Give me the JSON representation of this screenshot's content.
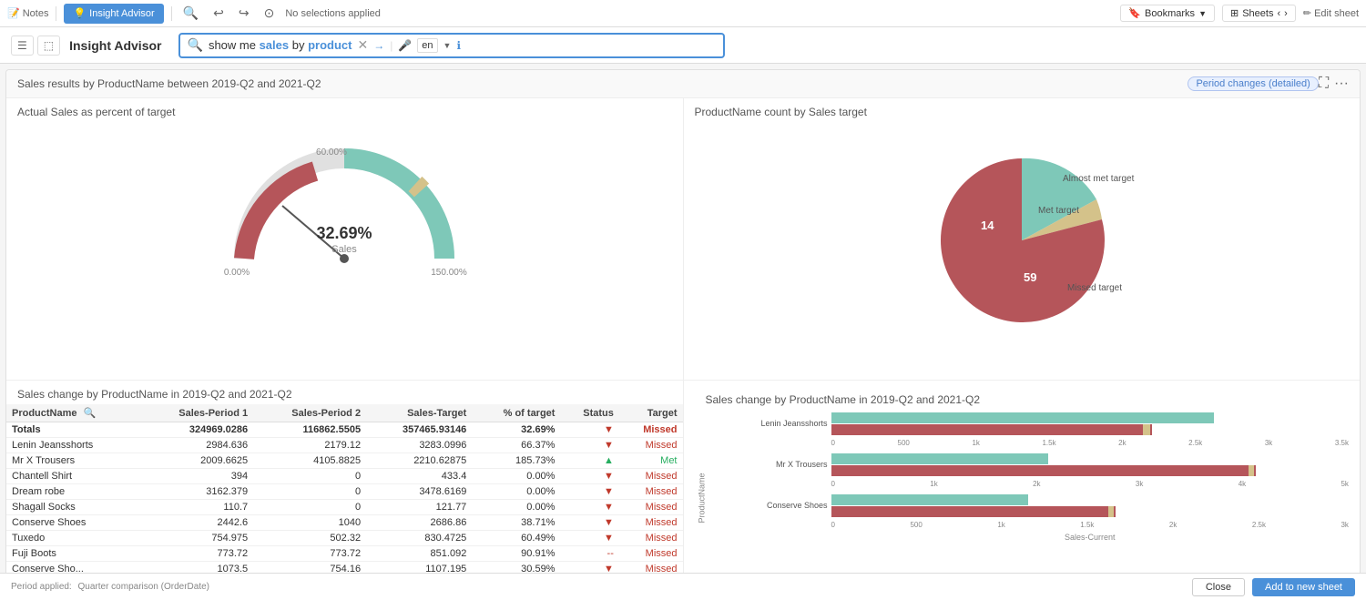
{
  "toolbar": {
    "notes_label": "Notes",
    "insight_advisor_label": "Insight Advisor",
    "no_selections": "No selections applied",
    "bookmarks_label": "Bookmarks",
    "sheets_label": "Sheets",
    "edit_sheet_label": "Edit sheet"
  },
  "second_bar": {
    "insight_advisor_title": "Insight Advisor"
  },
  "search": {
    "prefix": "show me ",
    "bold1": "sales",
    "middle": " by ",
    "bold2": "product",
    "lang": "en"
  },
  "results": {
    "title": "Sales results by ProductName between 2019-Q2 and 2021-Q2",
    "badge": "Period changes (detailed)",
    "chart1_title": "Actual Sales as percent of target",
    "chart2_title": "ProductName count by Sales target",
    "chart3_title": "Sales change by ProductName in 2019-Q2 and 2021-Q2",
    "chart4_title": "Sales change by ProductName in 2019-Q2 and 2021-Q2"
  },
  "gauge": {
    "center_value": "32.69%",
    "center_label": "Sales",
    "label_0": "0.00%",
    "label_60": "60.00%",
    "label_150": "150.00%",
    "percent": 32.69
  },
  "pie": {
    "segments": [
      {
        "label": "Missed target",
        "value": 59,
        "color": "#b5555a"
      },
      {
        "label": "Met target",
        "value": 14,
        "color": "#7ec8b8"
      },
      {
        "label": "Almost met target",
        "value": 3,
        "color": "#d4c28a"
      }
    ]
  },
  "table": {
    "columns": [
      "ProductName",
      "Sales-Period 1",
      "Sales-Period 2",
      "Sales-Target",
      "% of target",
      "Status",
      "Target"
    ],
    "search_icon": "🔍",
    "rows": [
      {
        "name": "Totals",
        "p1": "324969.0286",
        "p2": "116862.5505",
        "target": "357465.93146",
        "pct": "32.69%",
        "arrow": "▼",
        "status": "Missed",
        "status_class": "status-missed",
        "is_total": true
      },
      {
        "name": "Lenin Jeansshorts",
        "p1": "2984.636",
        "p2": "2179.12",
        "target": "3283.0996",
        "pct": "66.37%",
        "arrow": "▼",
        "status": "Missed",
        "status_class": "status-missed",
        "is_total": false
      },
      {
        "name": "Mr X Trousers",
        "p1": "2009.6625",
        "p2": "4105.8825",
        "target": "2210.62875",
        "pct": "185.73%",
        "arrow": "▲",
        "status": "Met",
        "status_class": "status-met",
        "is_total": false
      },
      {
        "name": "Chantell Shirt",
        "p1": "394",
        "p2": "0",
        "target": "433.4",
        "pct": "0.00%",
        "arrow": "▼",
        "status": "Missed",
        "status_class": "status-missed",
        "is_total": false
      },
      {
        "name": "Dream robe",
        "p1": "3162.379",
        "p2": "0",
        "target": "3478.6169",
        "pct": "0.00%",
        "arrow": "▼",
        "status": "Missed",
        "status_class": "status-missed",
        "is_total": false
      },
      {
        "name": "Shagall Socks",
        "p1": "110.7",
        "p2": "0",
        "target": "121.77",
        "pct": "0.00%",
        "arrow": "▼",
        "status": "Missed",
        "status_class": "status-missed",
        "is_total": false
      },
      {
        "name": "Conserve Shoes",
        "p1": "2442.6",
        "p2": "1040",
        "target": "2686.86",
        "pct": "38.71%",
        "arrow": "▼",
        "status": "Missed",
        "status_class": "status-missed",
        "is_total": false
      },
      {
        "name": "Tuxedo",
        "p1": "754.975",
        "p2": "502.32",
        "target": "830.4725",
        "pct": "60.49%",
        "arrow": "▼",
        "status": "Missed",
        "status_class": "status-missed",
        "is_total": false
      },
      {
        "name": "Fuji Boots",
        "p1": "773.72",
        "p2": "773.72",
        "target": "851.092",
        "pct": "90.91%",
        "arrow": "--",
        "status": "Missed",
        "status_class": "status-missed",
        "is_total": false
      },
      {
        "name": "Conserve Sho...",
        "p1": "1073.5",
        "p2": "754.16",
        "target": "1107.195",
        "pct": "30.59%",
        "arrow": "▼",
        "status": "Missed",
        "status_class": "status-missed",
        "is_total": false
      }
    ]
  },
  "bar_chart": {
    "y_label": "ProductName",
    "x_label": "Sales-Current",
    "rows": [
      {
        "label": "Lenin Jeansshorts",
        "bar1_width": 74,
        "bar2_width": 12,
        "bar_accent_width": 3,
        "axis_labels": [
          "0",
          "500",
          "1k",
          "1.5k",
          "2k",
          "2.5k",
          "3k",
          "3.5k"
        ],
        "max": 3500
      },
      {
        "label": "Mr X Trousers",
        "bar1_width": 42,
        "bar2_width": 55,
        "bar_accent_width": 3,
        "axis_labels": [
          "0",
          "1k",
          "2k",
          "3k",
          "4k",
          "5k"
        ],
        "max": 5000
      },
      {
        "label": "Conserve Shoes",
        "bar1_width": 38,
        "bar2_width": 50,
        "bar_accent_width": 3,
        "axis_labels": [
          "0",
          "500",
          "1k",
          "1.5k",
          "2k",
          "2.5k",
          "3k"
        ],
        "max": 3000
      }
    ]
  },
  "footer": {
    "period_label": "Period applied:",
    "period_value": "Quarter comparison (OrderDate)",
    "close_btn": "Close",
    "add_btn": "Add to new sheet"
  },
  "icons": {
    "notes": "📝",
    "insight": "💡",
    "search": "🔍",
    "mic": "🎤",
    "info": "ℹ",
    "expand": "⛶",
    "more": "⋯",
    "bookmark": "🔖",
    "grid": "⊞",
    "pencil": "✏",
    "undo": "↩",
    "redo": "↪",
    "nav_left": "‹",
    "nav_right": "›"
  }
}
